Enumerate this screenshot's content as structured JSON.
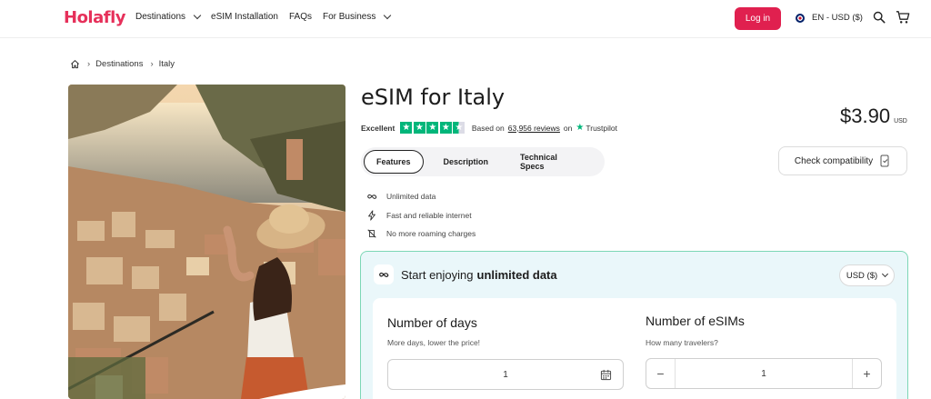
{
  "header": {
    "logo": "Holafly",
    "nav": [
      {
        "label": "Destinations",
        "has_dropdown": true
      },
      {
        "label": "eSIM Installation",
        "has_dropdown": false
      },
      {
        "label": "FAQs",
        "has_dropdown": false
      },
      {
        "label": "For Business",
        "has_dropdown": true
      }
    ],
    "login_label": "Log in",
    "language": "EN - USD ($)",
    "icons": [
      "search-icon",
      "cart-icon"
    ],
    "accent_color": "#e0204f"
  },
  "breadcrumb": [
    "Destinations",
    "Italy"
  ],
  "product": {
    "title": "eSIM for Italy",
    "rating": {
      "label": "Excellent",
      "stars": 4.5,
      "based_on": "Based on",
      "reviews": "63,956 reviews",
      "on": "on",
      "source": "Trustpilot"
    },
    "price": "$3.90",
    "price_unit": "USD",
    "tabs": [
      "Features",
      "Description",
      "Technical Specs"
    ],
    "active_tab": "Features",
    "check_compatibility": "Check compatibility",
    "features": [
      {
        "icon": "infinity-icon",
        "label": "Unlimited data"
      },
      {
        "icon": "lightning-icon",
        "label": "Fast and reliable internet"
      },
      {
        "icon": "no-roaming-icon",
        "label": "No more roaming charges"
      }
    ]
  },
  "plan": {
    "heading_prefix": "Start enjoying",
    "heading_bold": "unlimited data",
    "currency": "USD ($)",
    "days": {
      "title": "Number of days",
      "subtitle": "More days, lower the price!",
      "value": "1"
    },
    "esims": {
      "title": "Number of eSIMs",
      "subtitle": "How many travelers?",
      "value": "1",
      "minus": "−",
      "plus": "+"
    }
  }
}
